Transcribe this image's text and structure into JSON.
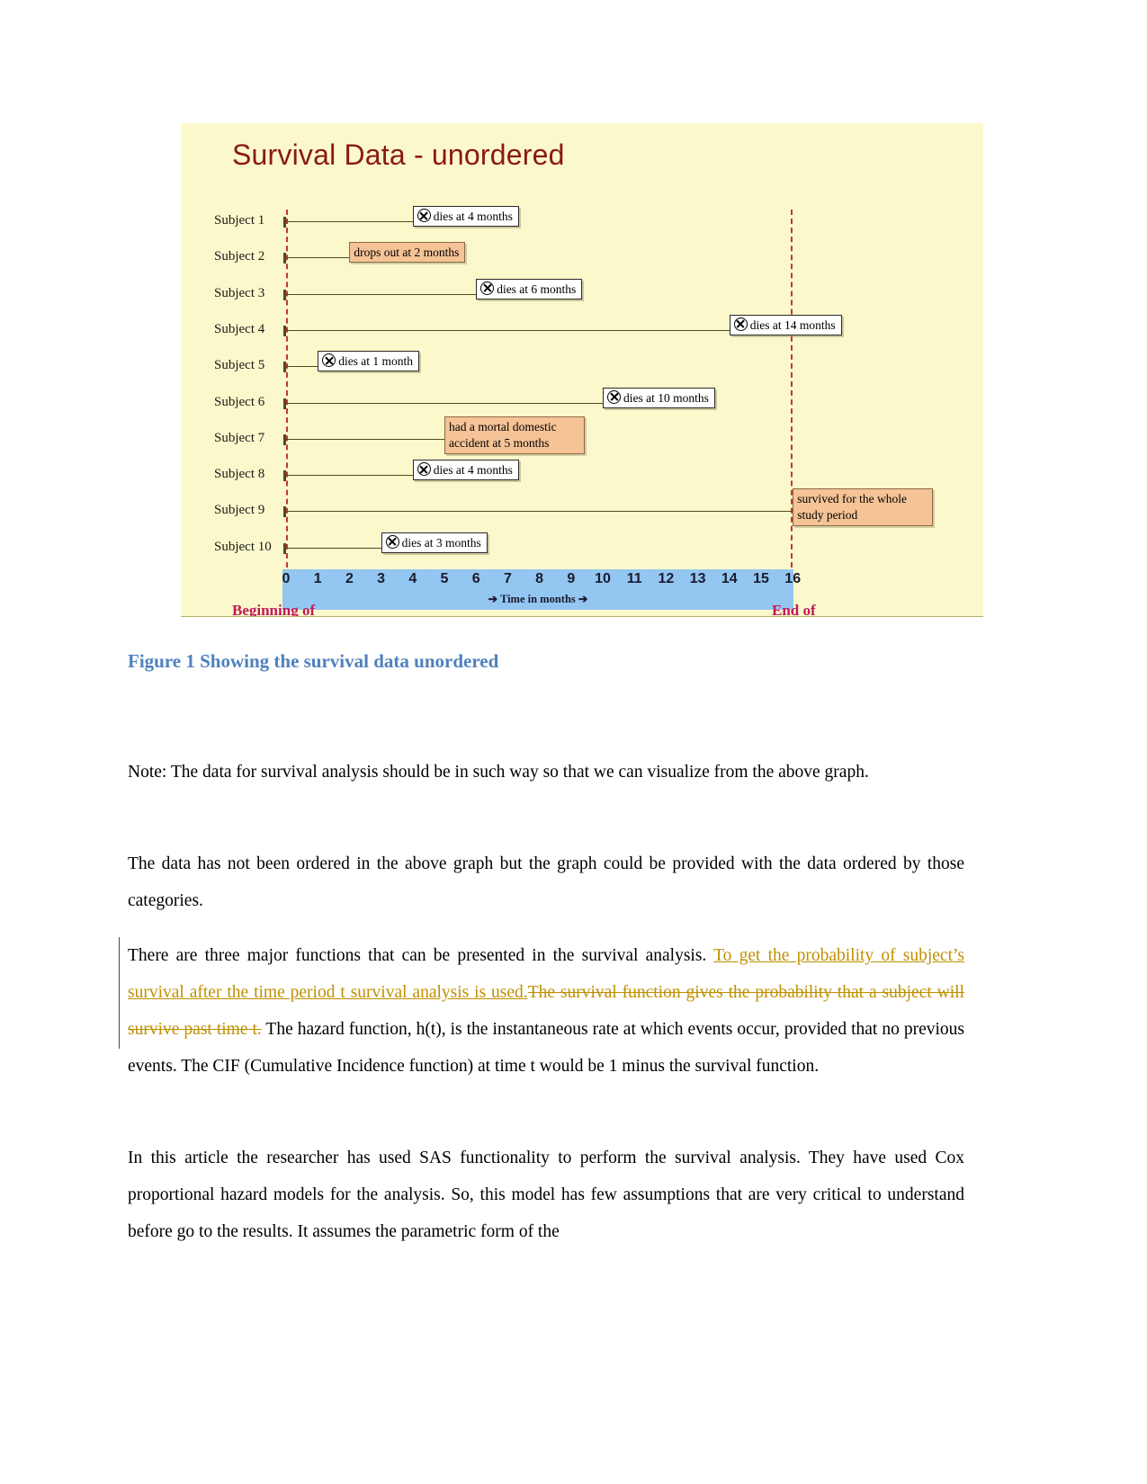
{
  "figure": {
    "title": "Survival Data - unordered",
    "axis_caption": "➔ Time in months ➔",
    "begin_label": "Beginning of",
    "end_label": "End of",
    "caption": "Figure 1 Showing the survival data unordered",
    "colors": {
      "panel_background": "#fbf8cc",
      "title": "#8b1a11",
      "reference_line": "#c0392b",
      "lifeline": "#4f4a22",
      "axis_band": "#93c6f0",
      "note_box": "#f5c396",
      "edge_label": "#c2185b",
      "caption": "#4f81bd"
    }
  },
  "chart_data": {
    "type": "bar",
    "title": "Survival Data - unordered",
    "xlabel": "➔ Time in months ➔",
    "ylabel": "",
    "xlim": [
      0,
      16
    ],
    "grid": false,
    "legend": "none",
    "tick_labels": [
      "0",
      "1",
      "2",
      "3",
      "4",
      "5",
      "6",
      "7",
      "8",
      "9",
      "10",
      "11",
      "12",
      "13",
      "14",
      "15",
      "16"
    ],
    "study_start": 0,
    "study_end": 16,
    "categories": [
      "Subject 1",
      "Subject 2",
      "Subject 3",
      "Subject 4",
      "Subject 5",
      "Subject 6",
      "Subject 7",
      "Subject 8",
      "Subject 9",
      "Subject 10"
    ],
    "values": [
      4,
      2,
      6,
      14,
      1,
      10,
      5,
      4,
      16,
      3
    ],
    "subjects": [
      {
        "label": "Subject 1",
        "time": 4,
        "event": "death",
        "annotation": "dies at 4 months",
        "box": "death"
      },
      {
        "label": "Subject 2",
        "time": 2,
        "event": "censored",
        "annotation": "drops out at 2 months",
        "box": "note"
      },
      {
        "label": "Subject 3",
        "time": 6,
        "event": "death",
        "annotation": "dies at 6 months",
        "box": "death"
      },
      {
        "label": "Subject 4",
        "time": 14,
        "event": "death",
        "annotation": "dies at 14 months",
        "box": "death"
      },
      {
        "label": "Subject 5",
        "time": 1,
        "event": "death",
        "annotation": "dies at 1 month",
        "box": "death"
      },
      {
        "label": "Subject 6",
        "time": 10,
        "event": "death",
        "annotation": "dies at 10 months",
        "box": "death"
      },
      {
        "label": "Subject 7",
        "time": 5,
        "event": "competing",
        "annotation": "had a mortal domestic accident at 5 months",
        "box": "note"
      },
      {
        "label": "Subject 8",
        "time": 4,
        "event": "death",
        "annotation": "dies at 4 months",
        "box": "death"
      },
      {
        "label": "Subject 9",
        "time": 16,
        "event": "censored",
        "annotation": "survived for the whole study period",
        "box": "note"
      },
      {
        "label": "Subject 10",
        "time": 3,
        "event": "death",
        "annotation": "dies at 3 months",
        "box": "death"
      }
    ]
  },
  "body": {
    "p1": "Note: The data for survival analysis should be in such way so that we can visualize from the above graph.",
    "p2": "The data has not been ordered in the above graph but the graph could be provided with the data ordered by those categories.",
    "p3": {
      "lead": "There are three major functions that can be presented in the survival analysis. ",
      "inserted": "To get the probability of  subject’s survival after the time period t survival analysis is used.",
      "deleted": "The survival function gives the probability that a subject will survive past time t.",
      "tail": " The hazard function, h(t), is the instantaneous rate at which events occur, provided that no previous events. The CIF (Cumulative Incidence function) at time t would be 1 minus the survival function."
    },
    "p4": "In this article the researcher has used SAS functionality to perform the survival analysis. They have used Cox proportional hazard models for the analysis. So, this model has few assumptions that are very critical to understand before go to the results. It assumes the parametric form of the"
  }
}
